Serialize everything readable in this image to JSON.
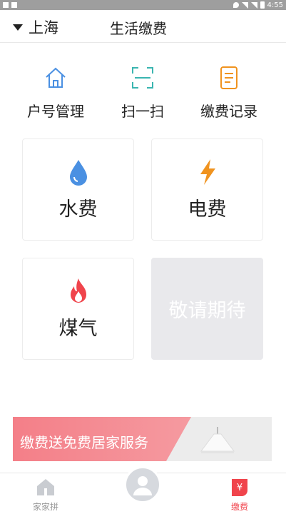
{
  "status_bar": {
    "time": "4:55"
  },
  "header": {
    "city": "上海",
    "title": "生活缴费"
  },
  "quick_actions": [
    {
      "label": "户号管理",
      "icon": "house-icon"
    },
    {
      "label": "扫一扫",
      "icon": "scan-icon"
    },
    {
      "label": "缴费记录",
      "icon": "document-icon"
    }
  ],
  "services": [
    {
      "label": "水费",
      "icon": "water-drop-icon"
    },
    {
      "label": "电费",
      "icon": "lightning-icon"
    },
    {
      "label": "煤气",
      "icon": "flame-icon"
    },
    {
      "label": "敬请期待",
      "icon": ""
    }
  ],
  "banner": {
    "text": "缴费送免费居家服务"
  },
  "tabs": [
    {
      "label": "家家拼",
      "icon": "home-tab-icon"
    },
    {
      "label": "",
      "icon": "user-avatar-icon"
    },
    {
      "label": "缴费",
      "icon": "yen-icon"
    }
  ],
  "colors": {
    "accent_blue": "#4a90e2",
    "accent_teal": "#3ab5b0",
    "accent_orange": "#f0931f",
    "accent_red": "#f0444c"
  }
}
